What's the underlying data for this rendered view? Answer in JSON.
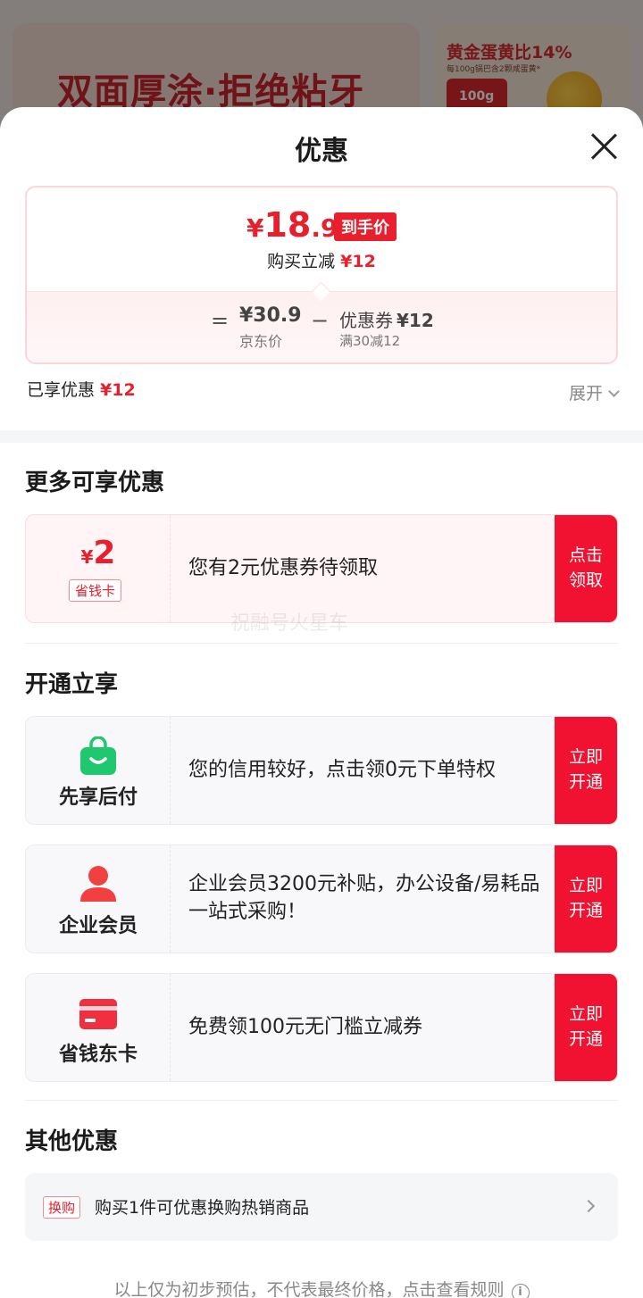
{
  "background": {
    "banner_left_text": "双面厚涂·拒绝粘牙",
    "banner_right_title": "黄金蛋黄比14%",
    "banner_right_sub": "每100g锅巴含2颗咸蛋黄*",
    "banner_right_box": "100g"
  },
  "sheet": {
    "title": "优惠",
    "close_icon": "close-icon"
  },
  "price_card": {
    "currency": "¥",
    "final_int": "18",
    "final_dec": ".9",
    "final_tag": "到手价",
    "reduce_label": "购买立减",
    "reduce_amount": "¥12",
    "eq_symbol": "=",
    "jd_price": "¥30.9",
    "jd_label": "京东价",
    "minus_symbol": "−",
    "coupon_label": "优惠券",
    "coupon_amount": "¥12",
    "coupon_condition": "满30减12"
  },
  "enjoyed": {
    "label": "已享优惠",
    "amount": "¥12",
    "expand_label": "展开"
  },
  "more_offers": {
    "title": "更多可享优惠",
    "item": {
      "currency": "¥",
      "value": "2",
      "badge": "省钱卡",
      "description": "您有2元优惠券待领取",
      "action": "点击领取"
    }
  },
  "watermark": "祝融号火星车",
  "open_enjoy": {
    "title": "开通立享",
    "items": [
      {
        "label": "先享后付",
        "icon": "shopping-bag-icon",
        "description": "您的信用较好，点击领0元下单特权",
        "action": "立即开通"
      },
      {
        "label": "企业会员",
        "icon": "person-icon",
        "description": "企业会员3200元补贴，办公设备/易耗品一站式采购！",
        "action": "立即开通"
      },
      {
        "label": "省钱东卡",
        "icon": "card-icon",
        "description": "免费领100元无门槛立减券",
        "action": "立即开通"
      }
    ]
  },
  "other_offers": {
    "title": "其他优惠",
    "tag": "换购",
    "text": "购买1件可优惠换购热销商品"
  },
  "footnote": "以上仅为初步预估，不代表最终价格，点击查看规则",
  "colors": {
    "accent_red": "#e8202e",
    "action_red": "#f01230",
    "green_icon": "#1fc76e"
  }
}
